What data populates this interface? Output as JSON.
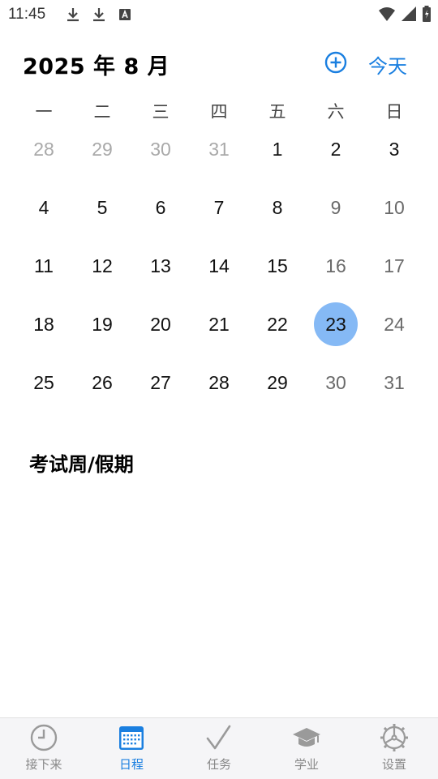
{
  "status_bar": {
    "time": "11:45",
    "left_icons": [
      "download-icon",
      "download-icon",
      "text-input-icon"
    ],
    "right_icons": [
      "wifi-icon",
      "signal-icon",
      "battery-icon"
    ]
  },
  "header": {
    "title": "2025 年 8 月",
    "add_icon": "plus-circle-icon",
    "today_label": "今天",
    "accent_color": "#1a7fe0"
  },
  "calendar": {
    "weekdays": [
      "一",
      "二",
      "三",
      "四",
      "五",
      "六",
      "日"
    ],
    "selected_color": "#85b9f5",
    "weeks": [
      [
        {
          "d": "28",
          "muted": true
        },
        {
          "d": "29",
          "muted": true
        },
        {
          "d": "30",
          "muted": true
        },
        {
          "d": "31",
          "muted": true
        },
        {
          "d": "1"
        },
        {
          "d": "2"
        },
        {
          "d": "3"
        }
      ],
      [
        {
          "d": "4"
        },
        {
          "d": "5"
        },
        {
          "d": "6"
        },
        {
          "d": "7"
        },
        {
          "d": "8"
        },
        {
          "d": "9",
          "weekend": true
        },
        {
          "d": "10",
          "weekend": true
        }
      ],
      [
        {
          "d": "11"
        },
        {
          "d": "12"
        },
        {
          "d": "13"
        },
        {
          "d": "14"
        },
        {
          "d": "15"
        },
        {
          "d": "16",
          "weekend": true
        },
        {
          "d": "17",
          "weekend": true
        }
      ],
      [
        {
          "d": "18"
        },
        {
          "d": "19"
        },
        {
          "d": "20"
        },
        {
          "d": "21"
        },
        {
          "d": "22"
        },
        {
          "d": "23",
          "selected": true
        },
        {
          "d": "24",
          "weekend": true
        }
      ],
      [
        {
          "d": "25"
        },
        {
          "d": "26"
        },
        {
          "d": "27"
        },
        {
          "d": "28"
        },
        {
          "d": "29"
        },
        {
          "d": "30",
          "weekend": true
        },
        {
          "d": "31",
          "weekend": true
        }
      ]
    ]
  },
  "section": {
    "title": "考试周/假期"
  },
  "bottom_nav": {
    "items": [
      {
        "label": "接下来",
        "icon": "clock-icon",
        "active": false
      },
      {
        "label": "日程",
        "icon": "calendar-icon",
        "active": true
      },
      {
        "label": "任务",
        "icon": "checkmark-icon",
        "active": false
      },
      {
        "label": "学业",
        "icon": "graduation-cap-icon",
        "active": false
      },
      {
        "label": "设置",
        "icon": "gear-icon",
        "active": false
      }
    ]
  }
}
